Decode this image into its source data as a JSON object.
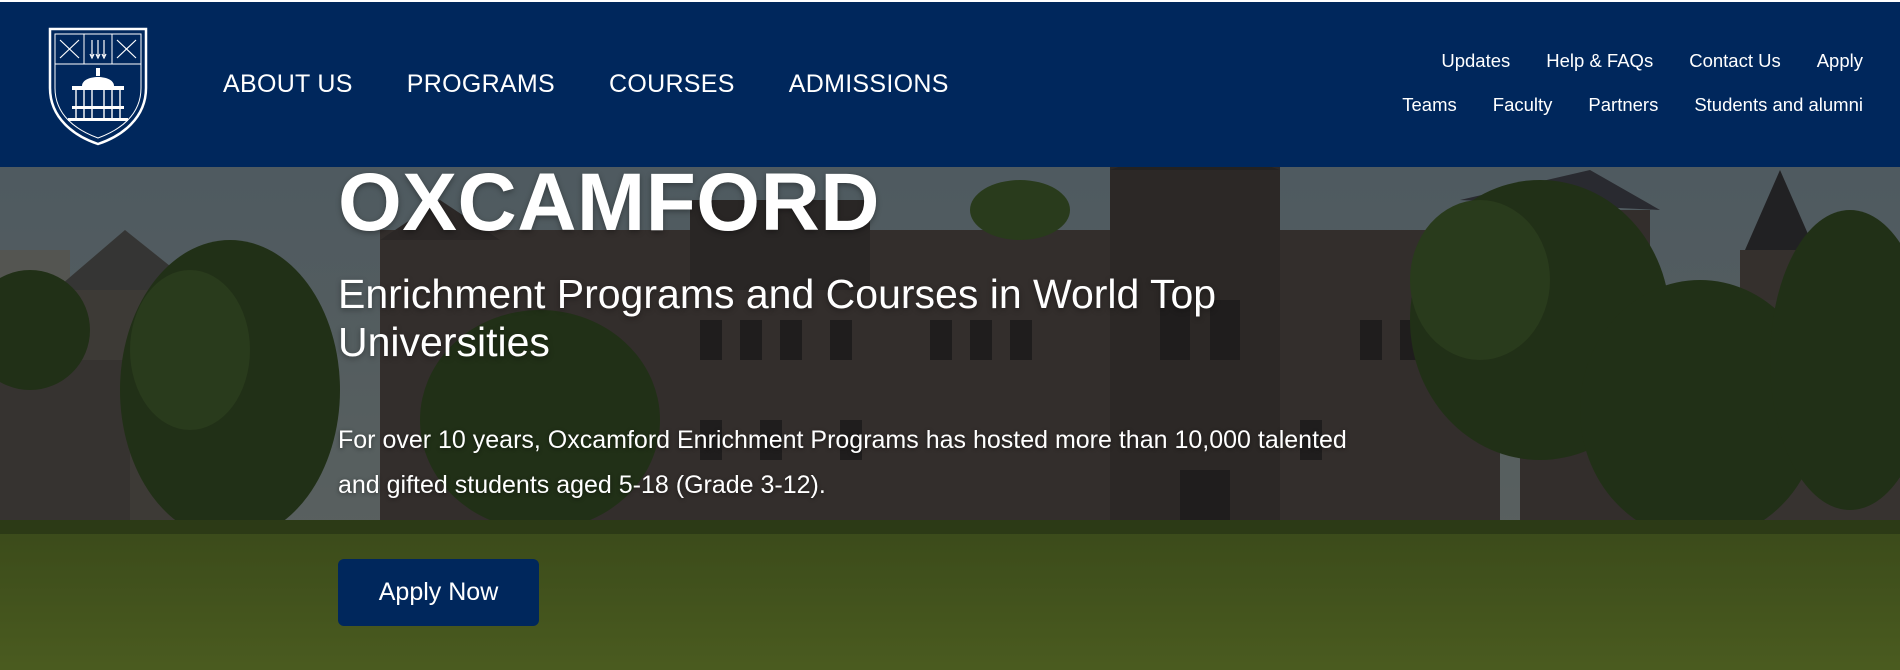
{
  "header": {
    "logo_icon": "university-crest-icon",
    "main_nav": [
      {
        "label": "ABOUT US"
      },
      {
        "label": "PROGRAMS"
      },
      {
        "label": "COURSES"
      },
      {
        "label": "ADMISSIONS"
      }
    ],
    "util_nav_row1": [
      {
        "label": "Updates"
      },
      {
        "label": "Help & FAQs"
      },
      {
        "label": "Contact Us"
      },
      {
        "label": "Apply"
      }
    ],
    "util_nav_row2": [
      {
        "label": "Teams"
      },
      {
        "label": "Faculty"
      },
      {
        "label": "Partners"
      },
      {
        "label": "Students and alumni"
      }
    ]
  },
  "hero": {
    "title": "OXCAMFORD",
    "subtitle": "Enrichment Programs and Courses in World Top Universities",
    "description": "For over 10 years, Oxcamford Enrichment Programs has hosted more than 10,000 talented and gifted students aged 5-18 (Grade 3-12).",
    "cta_label": "Apply Now",
    "background": "university-campus-photo"
  },
  "colors": {
    "brand_navy": "#00275c",
    "text": "#ffffff"
  }
}
